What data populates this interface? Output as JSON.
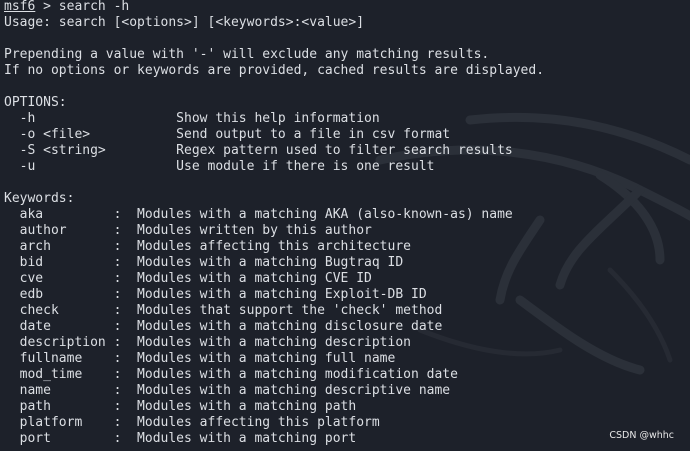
{
  "prompt": {
    "name": "msf6",
    "separator": " > ",
    "command": "search -h"
  },
  "usage": "Usage: search [<options>] [<keywords>:<value>]",
  "description": [
    "Prepending a value with '-' will exclude any matching results.",
    "If no options or keywords are provided, cached results are displayed."
  ],
  "options_header": "OPTIONS:",
  "options": [
    {
      "flag": "-h",
      "desc": "Show this help information"
    },
    {
      "flag": "-o <file>",
      "desc": "Send output to a file in csv format"
    },
    {
      "flag": "-S <string>",
      "desc": "Regex pattern used to filter search results"
    },
    {
      "flag": "-u",
      "desc": "Use module if there is one result"
    }
  ],
  "keywords_header": "Keywords:",
  "keywords": [
    {
      "key": "aka",
      "desc": "Modules with a matching AKA (also-known-as) name"
    },
    {
      "key": "author",
      "desc": "Modules written by this author"
    },
    {
      "key": "arch",
      "desc": "Modules affecting this architecture"
    },
    {
      "key": "bid",
      "desc": "Modules with a matching Bugtraq ID"
    },
    {
      "key": "cve",
      "desc": "Modules with a matching CVE ID"
    },
    {
      "key": "edb",
      "desc": "Modules with a matching Exploit-DB ID"
    },
    {
      "key": "check",
      "desc": "Modules that support the 'check' method"
    },
    {
      "key": "date",
      "desc": "Modules with a matching disclosure date"
    },
    {
      "key": "description",
      "desc": "Modules with a matching description"
    },
    {
      "key": "fullname",
      "desc": "Modules with a matching full name"
    },
    {
      "key": "mod_time",
      "desc": "Modules with a matching modification date"
    },
    {
      "key": "name",
      "desc": "Modules with a matching descriptive name"
    },
    {
      "key": "path",
      "desc": "Modules with a matching path"
    },
    {
      "key": "platform",
      "desc": "Modules affecting this platform"
    },
    {
      "key": "port",
      "desc": "Modules with a matching port"
    }
  ],
  "watermark": "CSDN @whhc",
  "colors": {
    "background": "#1d212a",
    "text": "#dcdfe4",
    "dragon_lines": "#2c313b"
  }
}
